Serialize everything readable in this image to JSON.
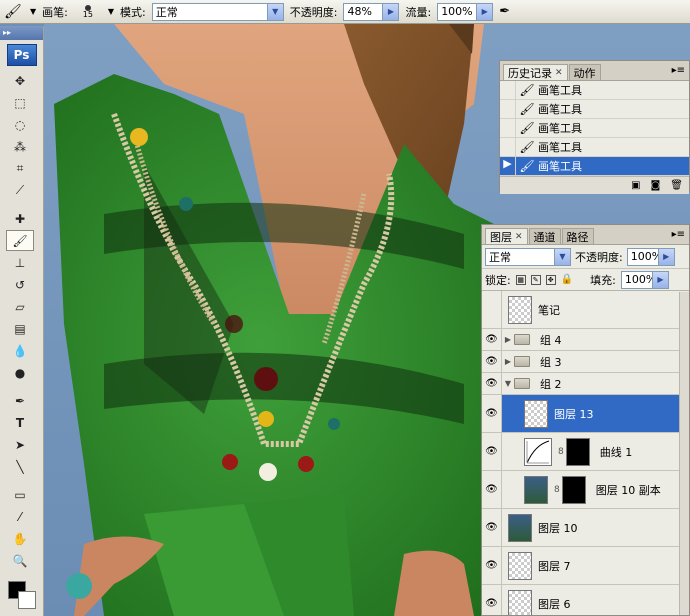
{
  "options_bar": {
    "brush_label": "画笔:",
    "brush_size": "15",
    "mode_label": "模式:",
    "mode_value": "正常",
    "opacity_label": "不透明度:",
    "opacity_value": "48%",
    "flow_label": "流量:",
    "flow_value": "100%"
  },
  "toolbox": {
    "logo": "Ps",
    "tools": [
      "move-tool",
      "marquee-tool",
      "lasso-tool",
      "magic-wand-tool",
      "crop-tool",
      "slice-tool",
      "healing-brush-tool",
      "brush-tool",
      "clone-stamp-tool",
      "history-brush-tool",
      "eraser-tool",
      "gradient-tool",
      "blur-tool",
      "dodge-tool",
      "pen-tool",
      "type-tool",
      "path-selection-tool",
      "line-tool",
      "notes-tool",
      "eyedropper-tool",
      "hand-tool",
      "zoom-tool"
    ],
    "active_tool": "brush-tool",
    "foreground_color": "#000000",
    "background_color": "#ffffff"
  },
  "history_panel": {
    "tabs": [
      "历史记录",
      "动作"
    ],
    "items": [
      "画笔工具",
      "画笔工具",
      "画笔工具",
      "画笔工具",
      "画笔工具"
    ],
    "selected_index": 4
  },
  "layers_panel": {
    "tabs": [
      "图层",
      "通道",
      "路径"
    ],
    "blend_mode": "正常",
    "opacity_label": "不透明度:",
    "opacity_value": "100%",
    "lock_label": "锁定:",
    "fill_label": "填充:",
    "fill_value": "100%",
    "layers": [
      {
        "name": "笔记",
        "type": "layer",
        "visible": false
      },
      {
        "name": "组 4",
        "type": "group",
        "visible": true
      },
      {
        "name": "组 3",
        "type": "group",
        "visible": true
      },
      {
        "name": "组 2",
        "type": "group-open",
        "visible": true
      },
      {
        "name": "图层 13",
        "type": "layer",
        "visible": true,
        "selected": true
      },
      {
        "name": "曲线 1",
        "type": "adjustment",
        "visible": true
      },
      {
        "name": "图层 10 副本",
        "type": "photo-mask",
        "visible": true
      },
      {
        "name": "图层 10",
        "type": "photo",
        "visible": true
      },
      {
        "name": "图层 7",
        "type": "layer",
        "visible": true
      },
      {
        "name": "图层 6",
        "type": "layer",
        "visible": true
      }
    ]
  },
  "colors": {
    "selection": "#316ac5",
    "dress_green": "#2f8a2c",
    "panel_bg": "#ecebe4"
  }
}
